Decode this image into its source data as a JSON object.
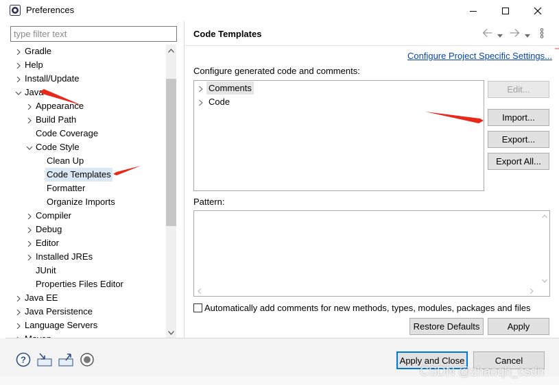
{
  "window": {
    "title": "Preferences",
    "controls": [
      "minimize",
      "maximize",
      "close"
    ]
  },
  "filter": {
    "placeholder": "type filter text",
    "value": ""
  },
  "tree": {
    "items": [
      {
        "label": "Gradle",
        "depth": 0,
        "expander": "collapsed"
      },
      {
        "label": "Help",
        "depth": 0,
        "expander": "collapsed"
      },
      {
        "label": "Install/Update",
        "depth": 0,
        "expander": "collapsed"
      },
      {
        "label": "Java",
        "depth": 0,
        "expander": "expanded"
      },
      {
        "label": "Appearance",
        "depth": 1,
        "expander": "collapsed"
      },
      {
        "label": "Build Path",
        "depth": 1,
        "expander": "collapsed"
      },
      {
        "label": "Code Coverage",
        "depth": 1,
        "expander": "none"
      },
      {
        "label": "Code Style",
        "depth": 1,
        "expander": "expanded"
      },
      {
        "label": "Clean Up",
        "depth": 2,
        "expander": "none"
      },
      {
        "label": "Code Templates",
        "depth": 2,
        "expander": "none",
        "selected": true
      },
      {
        "label": "Formatter",
        "depth": 2,
        "expander": "none"
      },
      {
        "label": "Organize Imports",
        "depth": 2,
        "expander": "none"
      },
      {
        "label": "Compiler",
        "depth": 1,
        "expander": "collapsed"
      },
      {
        "label": "Debug",
        "depth": 1,
        "expander": "collapsed"
      },
      {
        "label": "Editor",
        "depth": 1,
        "expander": "collapsed"
      },
      {
        "label": "Installed JREs",
        "depth": 1,
        "expander": "collapsed"
      },
      {
        "label": "JUnit",
        "depth": 1,
        "expander": "none"
      },
      {
        "label": "Properties Files Editor",
        "depth": 1,
        "expander": "none"
      },
      {
        "label": "Java EE",
        "depth": 0,
        "expander": "collapsed"
      },
      {
        "label": "Java Persistence",
        "depth": 0,
        "expander": "collapsed"
      },
      {
        "label": "Language Servers",
        "depth": 0,
        "expander": "collapsed"
      },
      {
        "label": "Maven",
        "depth": 0,
        "expander": "collapsed"
      }
    ]
  },
  "page": {
    "title": "Code Templates",
    "project_link": "Configure Project Specific Settings...",
    "configure_label": "Configure generated code and comments:",
    "templates": [
      {
        "label": "Comments",
        "highlighted": true
      },
      {
        "label": "Code",
        "highlighted": false
      }
    ],
    "buttons": {
      "edit": "Edit...",
      "import": "Import...",
      "export": "Export...",
      "export_all": "Export All..."
    },
    "pattern_label": "Pattern:",
    "pattern_value": "",
    "auto_comments_label": "Automatically add comments for new methods, types, modules, packages and files",
    "auto_comments_checked": false,
    "restore_defaults": "Restore Defaults",
    "apply": "Apply"
  },
  "footer": {
    "apply_close": "Apply and Close",
    "cancel": "Cancel",
    "icons": [
      "help-icon",
      "import-icon",
      "export-icon",
      "record-icon"
    ]
  },
  "watermark": "CSDN @zhaoqh_csdn",
  "colors": {
    "selection": "#dbe8f5",
    "link": "#0645ad",
    "focus": "#0078d7",
    "annotation_arrow": "#e8281b"
  }
}
